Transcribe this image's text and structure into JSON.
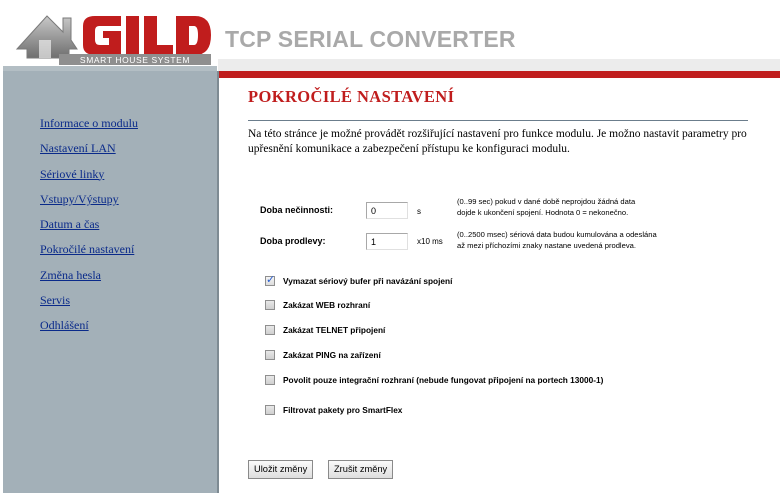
{
  "brand": {
    "logo_text": "GILD",
    "logo_tagline": "SMART HOUSE SYSTEM",
    "app_title": "TCP SERIAL CONVERTER",
    "accent_red": "#c01d1d",
    "sidebar_color": "#a3b0b8"
  },
  "sidebar": {
    "items": [
      {
        "label": "Informace o modulu"
      },
      {
        "label": "Nastavení LAN"
      },
      {
        "label": "Sériové linky"
      },
      {
        "label": "Vstupy/Výstupy"
      },
      {
        "label": "Datum a čas"
      },
      {
        "label": "Pokročilé nastavení"
      },
      {
        "label": "Změna hesla"
      },
      {
        "label": "Servis"
      },
      {
        "label": "Odhlášení"
      }
    ]
  },
  "main": {
    "title": "POKROČILÉ NASTAVENÍ",
    "intro": "Na této stránce je možné provádět rozšiřující nastavení pro funkce modulu. Je možno nastavit parametry pro upřesnění komunikace a zabezpečení přístupu ke konfiguraci modulu.",
    "idle": {
      "label": "Doba nečinnosti:",
      "value": "0",
      "unit": "s",
      "hint_line1": "(0..99 sec) pokud v dané době neprojdou žádná data",
      "hint_line2": "dojde k ukončení spojení. Hodnota 0 = nekonečno."
    },
    "delay": {
      "label": "Doba prodlevy:",
      "value": "1",
      "unit": "x10 ms",
      "hint_line1": "(0..2500 msec) sériová data budou kumulována a odeslána",
      "hint_line2": "až mezi příchozími znaky nastane uvedená prodleva."
    },
    "checkboxes": [
      {
        "label": "Vymazat sériový bufer při navázání spojení",
        "checked": true
      },
      {
        "label": "Zakázat WEB rozhraní",
        "checked": false
      },
      {
        "label": "Zakázat TELNET připojení",
        "checked": false
      },
      {
        "label": "Zakázat PING na zařízení",
        "checked": false
      },
      {
        "label": "Povolit pouze integrační rozhraní (nebude fungovat připojení na portech 13000-1)",
        "checked": false
      },
      {
        "label": "Filtrovat pakety pro SmartFlex",
        "checked": false
      }
    ],
    "save_label": "Uložit změny",
    "cancel_label": "Zrušit změny"
  }
}
